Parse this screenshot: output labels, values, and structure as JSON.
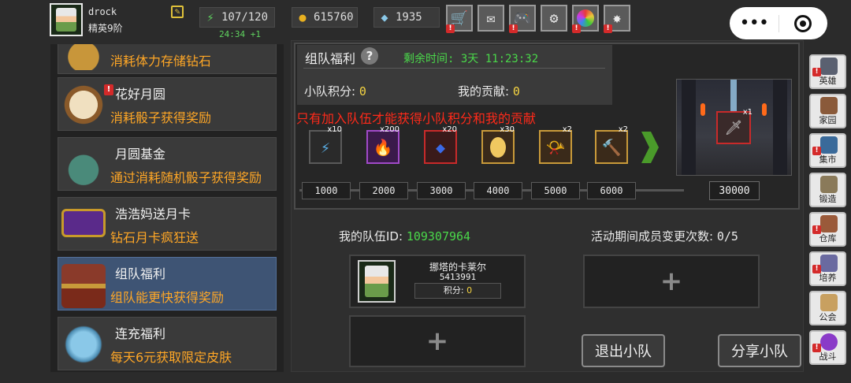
{
  "user": {
    "name": "drock",
    "rank": "精英9阶"
  },
  "stats": {
    "stamina": "107/120",
    "regen": "24:34 +1",
    "gold": "615760",
    "gems": "1935"
  },
  "menu": [
    {
      "title": "",
      "desc": "消耗体力存储钻石",
      "alert": false
    },
    {
      "title": "花好月圆",
      "desc": "消耗骰子获得奖励",
      "alert": true
    },
    {
      "title": "月圆基金",
      "desc": "通过消耗随机骰子获得奖励",
      "alert": false
    },
    {
      "title": "浩浩妈送月卡",
      "desc": "钻石月卡疯狂送",
      "alert": false
    },
    {
      "title": "组队福利",
      "desc": "组队能更快获得奖励",
      "alert": false
    },
    {
      "title": "连充福利",
      "desc": "每天6元获取限定皮肤",
      "alert": false
    }
  ],
  "panel": {
    "title": "组队福利",
    "help": "?",
    "remain": "剩余时间: 3天 11:23:32",
    "team_score_label": "小队积分:",
    "team_score": "0",
    "my_contrib_label": "我的贡献:",
    "my_contrib": "0",
    "warning": "只有加入队伍才能获得小队积分和我的贡献",
    "rewards": [
      {
        "count": "x10",
        "icon": "lightning-icon"
      },
      {
        "count": "x200",
        "icon": "flame-icon"
      },
      {
        "count": "x20",
        "icon": "blue-gem-icon"
      },
      {
        "count": "x30",
        "icon": "egg-icon"
      },
      {
        "count": "x2",
        "icon": "horn-icon"
      },
      {
        "count": "x2",
        "icon": "hammer-icon"
      }
    ],
    "thresholds": [
      "1000",
      "2000",
      "3000",
      "4000",
      "5000",
      "6000"
    ],
    "final_threshold": "30000",
    "grand_reward_count": "x1"
  },
  "team": {
    "id_label": "我的队伍ID:",
    "id": "109307964",
    "changes_label": "活动期间成员变更次数:",
    "changes": "0/5",
    "member": {
      "name": "挪塔的卡莱尔",
      "id": "5413991",
      "score_label": "积分:",
      "score": "0"
    },
    "leave_label": "退出小队",
    "share_label": "分享小队"
  },
  "sidebar": [
    {
      "label": "英雄",
      "alert": true,
      "color": "#5a6070"
    },
    {
      "label": "家园",
      "alert": false,
      "color": "#8a5a3a"
    },
    {
      "label": "集市",
      "alert": true,
      "color": "#3a6a9a"
    },
    {
      "label": "锻造",
      "alert": false,
      "color": "#8a7a5a"
    },
    {
      "label": "仓库",
      "alert": true,
      "color": "#9a5a3a"
    },
    {
      "label": "培养",
      "alert": true,
      "color": "#6a6aa0"
    },
    {
      "label": "公会",
      "alert": false,
      "color": "#c8a060"
    },
    {
      "label": "战斗",
      "alert": true,
      "color": "#8a3ac8"
    }
  ]
}
